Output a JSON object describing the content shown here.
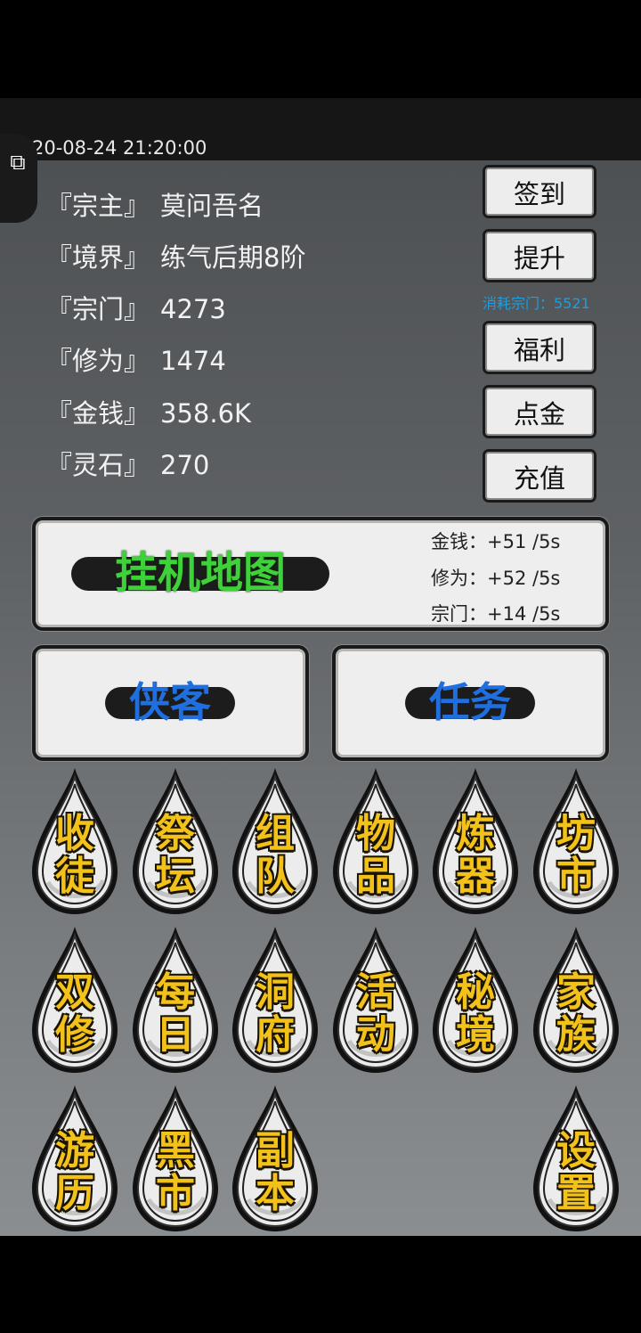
{
  "header": {
    "datetime": "20-08-24 21:20:00"
  },
  "stats": [
    {
      "key": "『宗主』",
      "value": "莫问吾名"
    },
    {
      "key": "『境界』",
      "value": "练气后期8阶"
    },
    {
      "key": "『宗门』",
      "value": "4273"
    },
    {
      "key": "『修为』",
      "value": "1474"
    },
    {
      "key": "『金钱』",
      "value": "358.6K"
    },
    {
      "key": "『灵石』",
      "value": "270"
    }
  ],
  "buttons": {
    "sign_in": "签到",
    "upgrade": "提升",
    "consume_note": "消耗宗门：5521",
    "welfare": "福利",
    "gold_click": "点金",
    "recharge": "充值"
  },
  "idle_map": {
    "label": "挂机地图",
    "rates": [
      {
        "label": "金钱：",
        "value": "+51 /5s"
      },
      {
        "label": "修为：",
        "value": "+52 /5s"
      },
      {
        "label": "宗门：",
        "value": "+14 /5s"
      }
    ]
  },
  "wanderer_label": "侠客",
  "mission_label": "任务",
  "menu_rows": [
    [
      [
        "收",
        "徒"
      ],
      [
        "祭",
        "坛"
      ],
      [
        "组",
        "队"
      ],
      [
        "物",
        "品"
      ],
      [
        "炼",
        "器"
      ],
      [
        "坊",
        "市"
      ]
    ],
    [
      [
        "双",
        "修"
      ],
      [
        "每",
        "日"
      ],
      [
        "洞",
        "府"
      ],
      [
        "活",
        "动"
      ],
      [
        "秘",
        "境"
      ],
      [
        "家",
        "族"
      ]
    ],
    [
      [
        "游",
        "历"
      ],
      [
        "黑",
        "市"
      ],
      [
        "副",
        "本"
      ],
      null,
      null,
      [
        "设",
        "置"
      ]
    ]
  ],
  "colors": {
    "menu_text": "#f2c21a",
    "idle_map_text": "#3ed13a",
    "blue_text": "#1f6fe0",
    "consume_text": "#1d9ee0"
  },
  "icons": {
    "side_icon": "puzzle-piece-icon"
  }
}
